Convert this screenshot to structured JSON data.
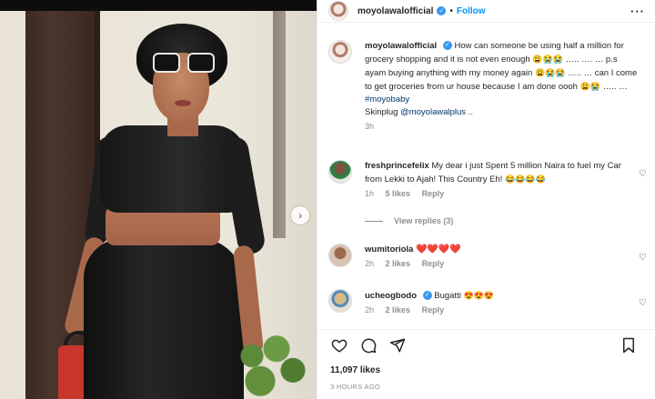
{
  "post": {
    "username": "moyolawalofficial",
    "follow_label": "Follow",
    "separator": "•",
    "more_label": "···",
    "next_label": "›"
  },
  "caption": {
    "username": "moyolawalofficial",
    "text_1": "How can someone be using half a million for grocery shopping and it is not even enough ",
    "emoji_1": "😩😭😭",
    "text_2": "….. …. … p.s ayam buying anything with my money again ",
    "emoji_2": "😩😭😭",
    "text_3": "….. … can I come to get groceries from ur house because I am done oooh ",
    "emoji_3": "😩😭",
    "text_4": "….. …",
    "hashtag": "#moyobaby",
    "skinplug_label": "Skinplug ",
    "skinplug_handle": "@moyolawalplus",
    "skinplug_tail": " ..",
    "time": "3h"
  },
  "comments": [
    {
      "username": "freshprincefelix",
      "text": "My dear i just Spent 5 million Naira to fuel my Car from Lekki to Ajah! This Country Eh! ",
      "emoji": "😂😂😂😂",
      "time": "1h",
      "likes": "5 likes",
      "reply": "Reply"
    },
    {
      "username": "wumitoriola",
      "text": "",
      "emoji": "❤️❤️❤️❤️",
      "time": "2h",
      "likes": "2 likes",
      "reply": "Reply"
    },
    {
      "username": "ucheogbodo",
      "text": "Bugatti ",
      "emoji": "😍😍😍",
      "time": "2h",
      "likes": "2 likes",
      "reply": "Reply"
    }
  ],
  "view_replies": "View replies (3)",
  "likes_count": "11,097 likes",
  "timestamp": "3 HOURS AGO",
  "icons": {
    "verified": "verified-badge-icon",
    "heart": "heart-icon",
    "comment": "comment-icon",
    "share": "send-icon",
    "bookmark": "bookmark-icon",
    "next": "chevron-right-icon"
  },
  "colors": {
    "link": "#00376b",
    "follow": "#0095f6",
    "verified": "#3897f0",
    "meta": "#8e8e8e"
  }
}
